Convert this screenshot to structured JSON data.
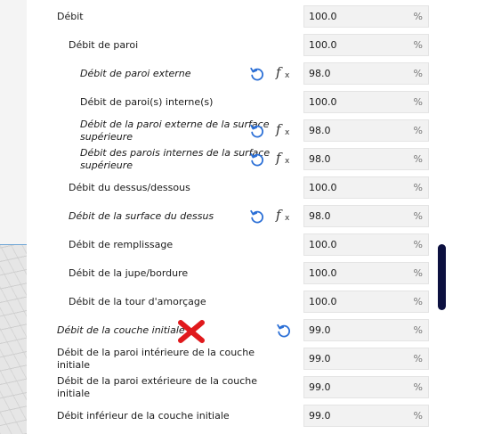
{
  "settings": [
    {
      "label": "Débit",
      "value": "100.0",
      "unit": "%"
    },
    {
      "label": "Débit de paroi",
      "value": "100.0",
      "unit": "%"
    },
    {
      "label": "Débit de paroi externe",
      "value": "98.0",
      "unit": "%"
    },
    {
      "label": "Débit de paroi(s) interne(s)",
      "value": "100.0",
      "unit": "%"
    },
    {
      "label": "Débit de la paroi externe de la surface supérieure",
      "value": "98.0",
      "unit": "%"
    },
    {
      "label": "Débit des parois internes de la surface supérieure",
      "value": "98.0",
      "unit": "%"
    },
    {
      "label": "Débit du dessus/dessous",
      "value": "100.0",
      "unit": "%"
    },
    {
      "label": "Débit de la surface du dessus",
      "value": "98.0",
      "unit": "%"
    },
    {
      "label": "Débit de remplissage",
      "value": "100.0",
      "unit": "%"
    },
    {
      "label": "Débit de la jupe/bordure",
      "value": "100.0",
      "unit": "%"
    },
    {
      "label": "Débit de la tour d'amorçage",
      "value": "100.0",
      "unit": "%"
    },
    {
      "label": "Débit de la couche initiale",
      "value": "99.0",
      "unit": "%"
    },
    {
      "label": "Débit de la paroi intérieure de la couche initiale",
      "value": "99.0",
      "unit": "%"
    },
    {
      "label": "Débit de la paroi extérieure de la couche initiale",
      "value": "99.0",
      "unit": "%"
    },
    {
      "label": "Débit inférieur de la couche initiale",
      "value": "99.0",
      "unit": "%"
    }
  ],
  "icons": {
    "reset": "reset-icon",
    "formula": "function-icon",
    "error": "error-cross-icon"
  },
  "colors": {
    "reset_icon": "#2b6fd6",
    "error_cross": "#e0191c",
    "scrollbar": "#0c1040"
  }
}
